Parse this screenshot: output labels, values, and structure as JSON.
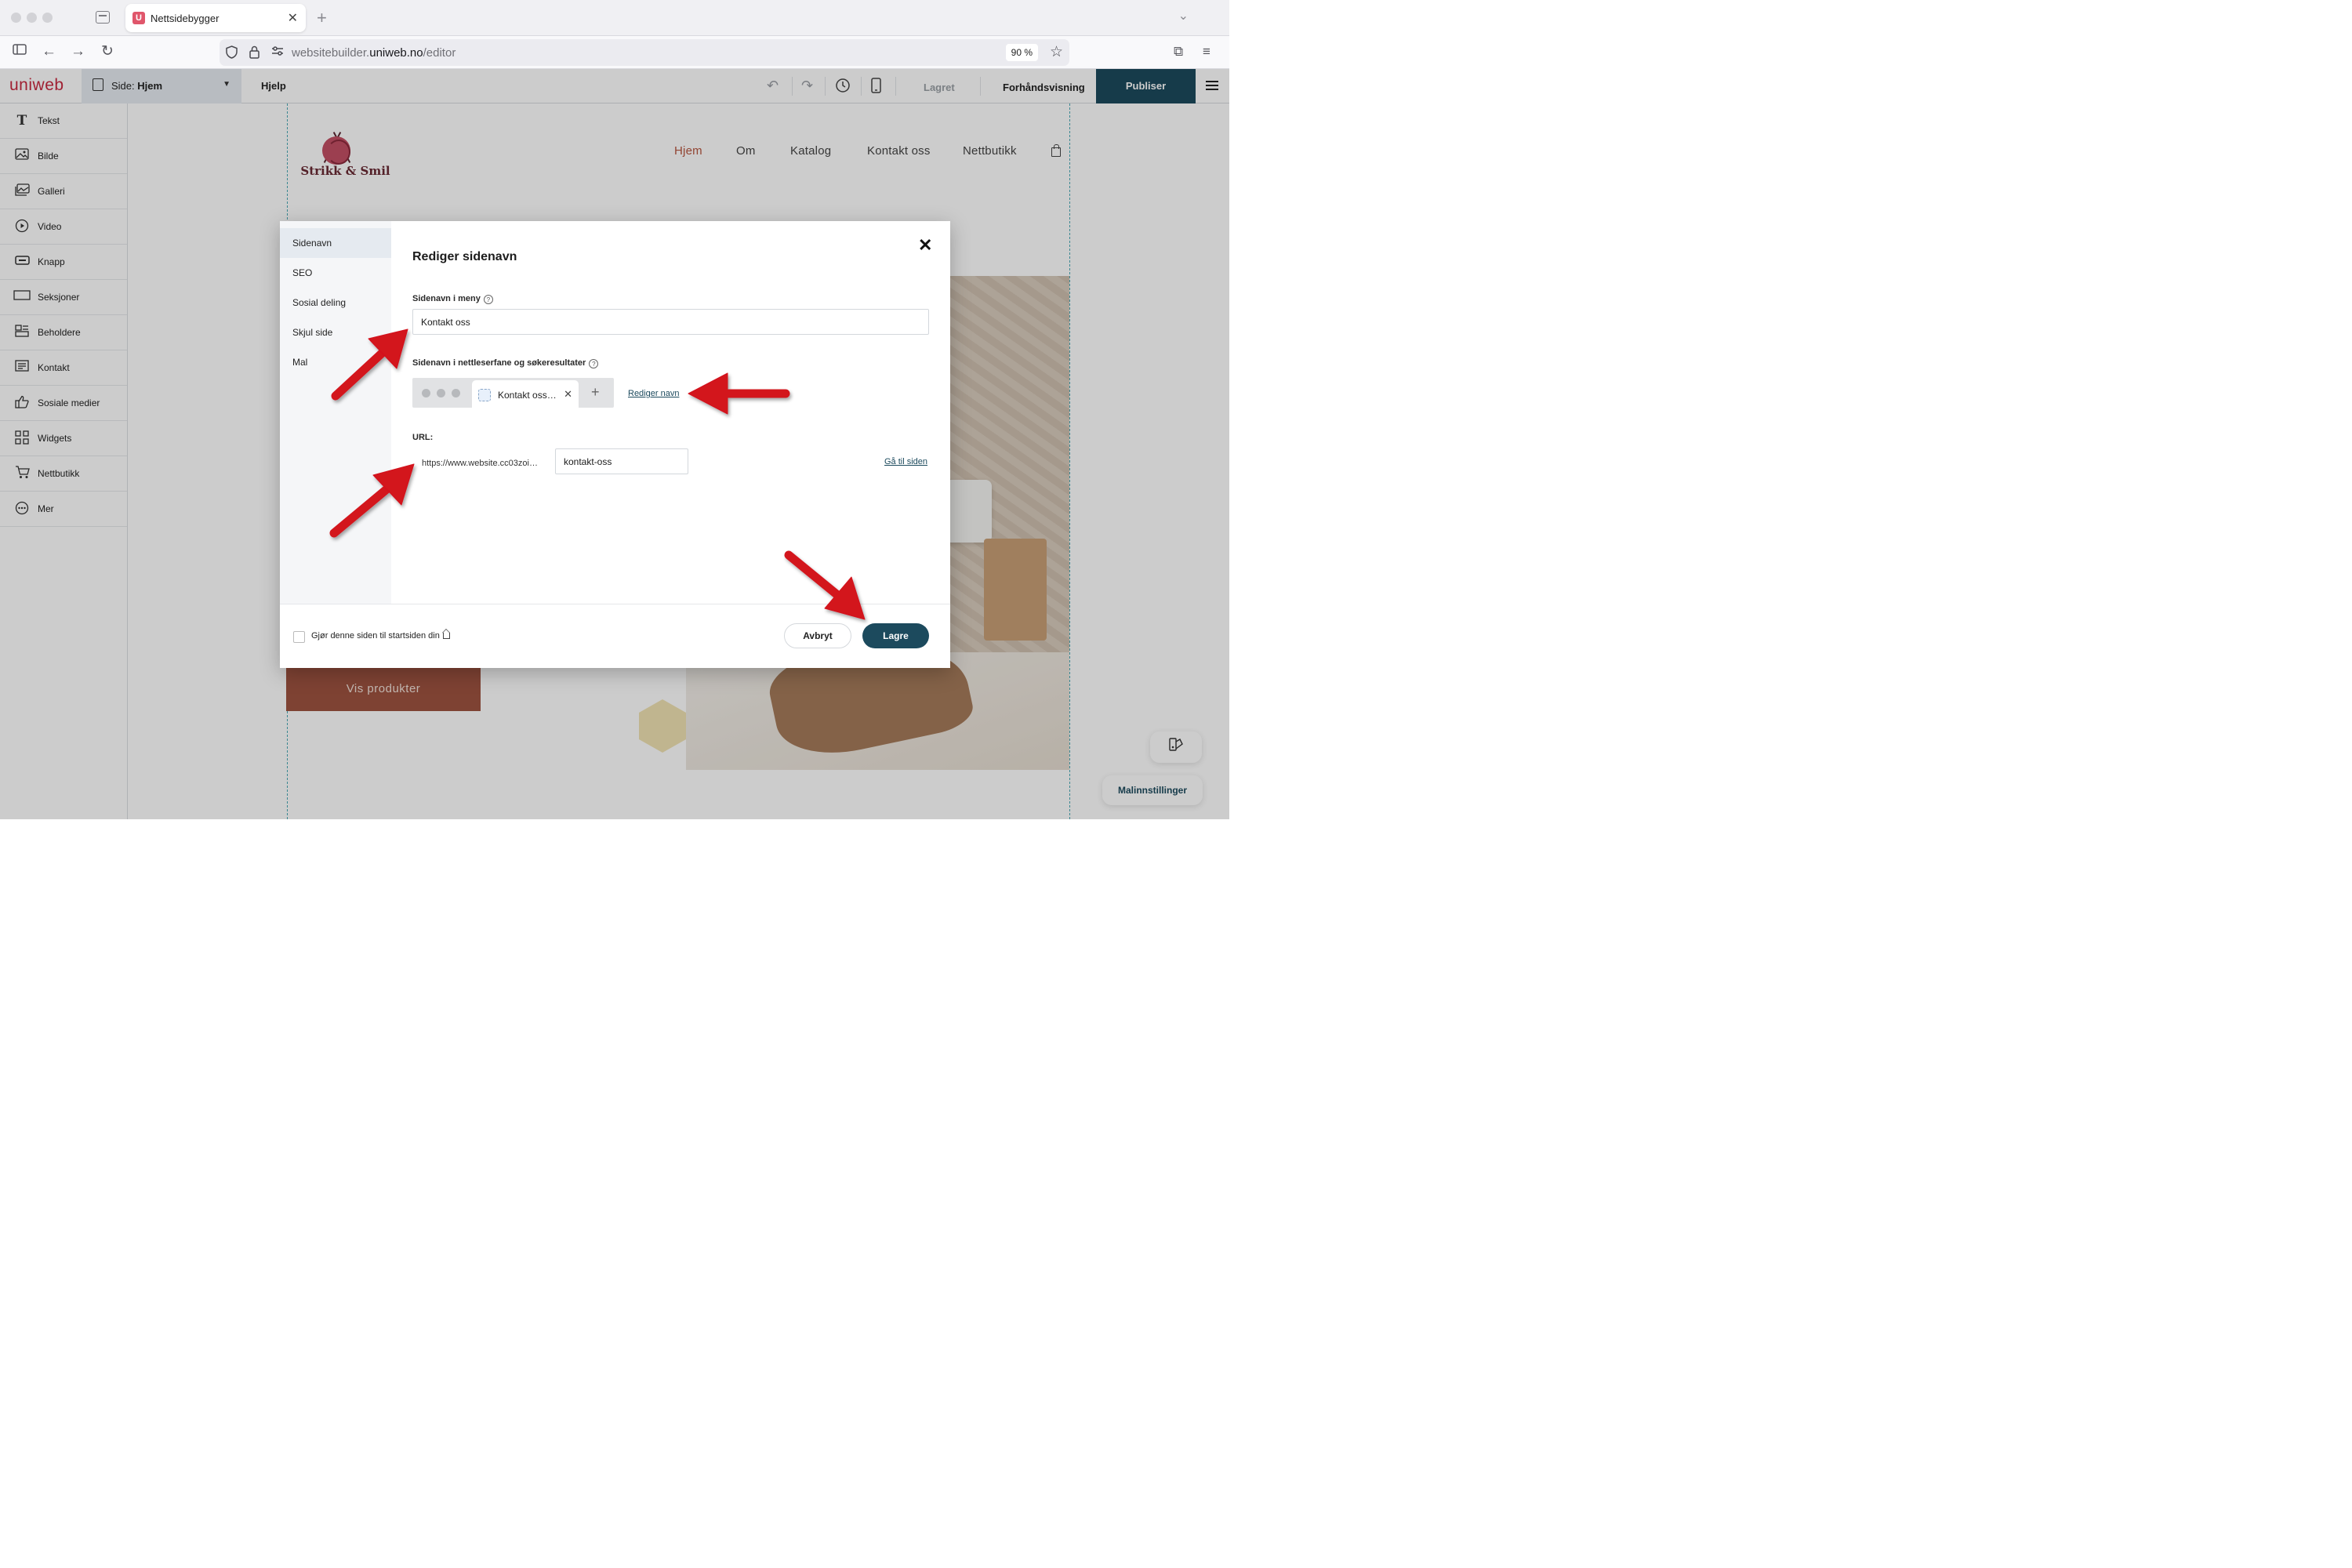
{
  "browser": {
    "tab_title": "Nettsidebygger",
    "tab_favicon": "U",
    "url_prefix": "websitebuilder.",
    "url_domain": "uniweb.no",
    "url_path": "/editor",
    "zoom": "90 %"
  },
  "toolbar": {
    "logo": "uniweb",
    "page_label": "Side:",
    "page_value": "Hjem",
    "help": "Hjelp",
    "saved": "Lagret",
    "preview": "Forhåndsvisning",
    "publish": "Publiser",
    "publish_color": "#1c4a5d"
  },
  "sidebar": {
    "items": [
      {
        "label": "Tekst",
        "icon": "text-icon"
      },
      {
        "label": "Bilde",
        "icon": "image-icon"
      },
      {
        "label": "Galleri",
        "icon": "gallery-icon"
      },
      {
        "label": "Video",
        "icon": "video-icon"
      },
      {
        "label": "Knapp",
        "icon": "button-icon"
      },
      {
        "label": "Seksjoner",
        "icon": "sections-icon"
      },
      {
        "label": "Beholdere",
        "icon": "containers-icon"
      },
      {
        "label": "Kontakt",
        "icon": "contact-icon"
      },
      {
        "label": "Sosiale medier",
        "icon": "thumbs-up-icon"
      },
      {
        "label": "Widgets",
        "icon": "widgets-icon"
      },
      {
        "label": "Nettbutikk",
        "icon": "cart-icon"
      },
      {
        "label": "Mer",
        "icon": "more-icon"
      }
    ]
  },
  "site": {
    "brand": "Strikk & Smil",
    "nav": [
      "Hjem",
      "Om",
      "Katalog",
      "Kontakt oss",
      "Nettbutikk"
    ],
    "cta": "Vis produkter",
    "template_settings": "Malinnstillinger"
  },
  "modal": {
    "tabs": [
      "Sidenavn",
      "SEO",
      "Sosial deling",
      "Skjul side",
      "Mal"
    ],
    "title": "Rediger sidenavn",
    "menu_name_label": "Sidenavn i meny",
    "menu_name_value": "Kontakt oss",
    "browser_tab_label": "Sidenavn i nettleserfane og søkeresultater",
    "browser_tab_preview": "Kontakt oss…",
    "edit_name_link": "Rediger navn",
    "url_label": "URL:",
    "url_prefix": "https://www.website.cc03zoi…",
    "url_slug": "kontakt-oss",
    "go_to_page_link": "Gå til siden",
    "homepage_checkbox": "Gjør denne siden til startsiden din",
    "cancel": "Avbryt",
    "save": "Lagre"
  }
}
